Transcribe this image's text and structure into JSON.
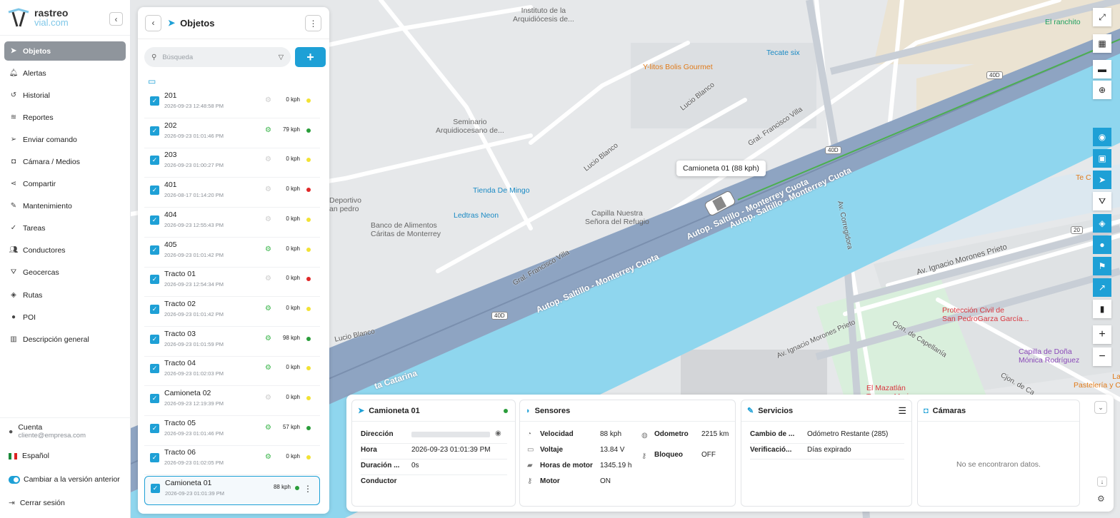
{
  "brand": {
    "line1": "rastreo",
    "line2": "vial.com"
  },
  "nav": {
    "items": [
      {
        "label": "Objetos",
        "icon": "navigation-arrow-icon",
        "active": true
      },
      {
        "label": "Alertas",
        "icon": "bell-icon"
      },
      {
        "label": "Historial",
        "icon": "history-icon"
      },
      {
        "label": "Reportes",
        "icon": "layers-icon"
      },
      {
        "label": "Enviar comando",
        "icon": "send-icon"
      },
      {
        "label": "Cámara / Medios",
        "icon": "camera-icon"
      },
      {
        "label": "Compartir",
        "icon": "share-icon"
      },
      {
        "label": "Mantenimiento",
        "icon": "wrench-icon"
      },
      {
        "label": "Tareas",
        "icon": "tasks-icon"
      },
      {
        "label": "Conductores",
        "icon": "users-icon"
      },
      {
        "label": "Geocercas",
        "icon": "geofence-icon"
      },
      {
        "label": "Rutas",
        "icon": "binoculars-icon"
      },
      {
        "label": "POI",
        "icon": "map-pin-icon"
      },
      {
        "label": "Descripción general",
        "icon": "bar-chart-icon"
      }
    ],
    "account_label": "Cuenta",
    "account_email": "cliente@empresa.com",
    "language": "Español",
    "legacy_toggle": "Cambiar a la versión anterior",
    "logout": "Cerrar sesión"
  },
  "objects": {
    "title": "Objetos",
    "search_placeholder": "Búsqueda",
    "rows": [
      {
        "name": "201",
        "date": "2026-09-23 12:48:58 PM",
        "speed": "0 kph",
        "status": "#f2e234",
        "engine": false
      },
      {
        "name": "202",
        "date": "2026-09-23 01:01:46 PM",
        "speed": "79 kph",
        "status": "#2a9d3a",
        "engine": true
      },
      {
        "name": "203",
        "date": "2026-09-23 01:00:27 PM",
        "speed": "0 kph",
        "status": "#f2e234",
        "engine": false
      },
      {
        "name": "401",
        "date": "2026-08-17 01:14:20 PM",
        "speed": "0 kph",
        "status": "#e02828",
        "engine": false
      },
      {
        "name": "404",
        "date": "2026-09-23 12:55:43 PM",
        "speed": "0 kph",
        "status": "#f2e234",
        "engine": false
      },
      {
        "name": "405",
        "date": "2026-09-23 01:01:42 PM",
        "speed": "0 kph",
        "status": "#f2e234",
        "engine": true
      },
      {
        "name": "Tracto 01",
        "date": "2026-09-23 12:54:34 PM",
        "speed": "0 kph",
        "status": "#e02828",
        "engine": false
      },
      {
        "name": "Tracto 02",
        "date": "2026-09-23 01:01:42 PM",
        "speed": "0 kph",
        "status": "#f2e234",
        "engine": true
      },
      {
        "name": "Tracto 03",
        "date": "2026-09-23 01:01:59 PM",
        "speed": "98 kph",
        "status": "#2a9d3a",
        "engine": true
      },
      {
        "name": "Tracto 04",
        "date": "2026-09-23 01:02:03 PM",
        "speed": "0 kph",
        "status": "#f2e234",
        "engine": true
      },
      {
        "name": "Camioneta 02",
        "date": "2026-09-23 12:19:39 PM",
        "speed": "0 kph",
        "status": "#f2e234",
        "engine": false
      },
      {
        "name": "Tracto 05",
        "date": "2026-09-23 01:01:46 PM",
        "speed": "57 kph",
        "status": "#2a9d3a",
        "engine": true
      },
      {
        "name": "Tracto 06",
        "date": "2026-09-23 01:02:05 PM",
        "speed": "0 kph",
        "status": "#f2e234",
        "engine": true
      },
      {
        "name": "Camioneta 01",
        "date": "2026-09-23 01:01:39 PM",
        "speed": "88 kph",
        "status": "#2a9d3a",
        "engine": false,
        "selected": true
      }
    ]
  },
  "map": {
    "tooltip": "Camioneta 01 (88 kph)",
    "labels": {
      "instituto": "Instituto de la\nArquidiócesis de...",
      "tecate": "Tecate six",
      "ylitos": "Y-litos Bolis Gourmet",
      "elranchito": "El ranchito",
      "seminario": "Seminario\nArquidiocesano de...",
      "tienda": "Tienda De Mingo",
      "ledtras": "Ledtras Neon",
      "capilla": "Capilla Nuestra\nSeñora del Refugio",
      "banco": "Banco de Alimentos\nCáritas de Monterrey",
      "deportivo": "Deportivo\nan pedro",
      "proteccion": "Protección Civil de\nSan PedroGarza García...",
      "capilladona": "Capilla de Doña\nMónica Rodríguez",
      "mazatlan": "El Mazatlán\nTacos y Mariscos",
      "pasteleria": "La\nPastelería y C",
      "tec": "Te C"
    },
    "roads": {
      "autop1": "Autop. Saltillo - Monterrey Cuota",
      "autop2": "Autop. Saltillo - Monterrey Cuota",
      "autop3": "Autop. Saltillo - Monterrey Cuota",
      "catarina": "ta Catarina",
      "lucio1": "Lucio Blanco",
      "lucio2": "Lucio Blanco",
      "lucio3": "Lucio Blanco",
      "villa1": "Gral. Francisco Villa",
      "villa2": "Gral. Francisco Villa",
      "corregidora": "Av. Corregidora",
      "morones1": "Av. Ignacio Morones Prieto",
      "morones2": "Av. Ignacio Morones Prieto",
      "capellania": "Cjon. de Capellanía",
      "capellania2": "Cjon. de Ca"
    },
    "shields": [
      "40D",
      "40D",
      "40D",
      "40D",
      "20"
    ]
  },
  "bottom": {
    "vehicle": {
      "title": "Camioneta 01",
      "rows": [
        {
          "k": "Dirección",
          "v": ""
        },
        {
          "k": "Hora",
          "v": "2026-09-23 01:01:39 PM"
        },
        {
          "k": "Duración ...",
          "v": "0s"
        },
        {
          "k": "Conductor",
          "v": ""
        }
      ]
    },
    "sensors": {
      "title": "Sensores",
      "left": [
        {
          "k": "Velocidad",
          "v": "88 kph",
          "icon": "gauge-icon"
        },
        {
          "k": "Voltaje",
          "v": "13.84 V",
          "icon": "battery-icon"
        },
        {
          "k": "Horas de motor",
          "v": "1345.19 h",
          "icon": "engine-icon"
        },
        {
          "k": "Motor",
          "v": "ON",
          "icon": "key-icon"
        }
      ],
      "right": [
        {
          "k": "Odometro",
          "v": "2215 km",
          "icon": "odometer-icon"
        },
        {
          "k": "Bloqueo",
          "v": "OFF",
          "icon": "key-icon"
        }
      ]
    },
    "services": {
      "title": "Servicios",
      "rows": [
        {
          "k": "Cambio de ...",
          "v": "Odómetro Restante (285)"
        },
        {
          "k": "Verificació...",
          "v": "Días expirado"
        }
      ]
    },
    "cameras": {
      "title": "Cámaras",
      "empty": "No se encontraron datos."
    }
  }
}
